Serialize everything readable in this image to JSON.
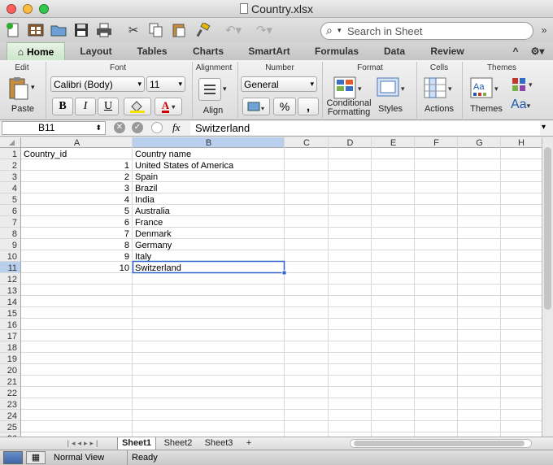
{
  "window": {
    "title": "Country.xlsx"
  },
  "toolbar": {
    "search_placeholder": "Search in Sheet"
  },
  "tabs": [
    "Home",
    "Layout",
    "Tables",
    "Charts",
    "SmartArt",
    "Formulas",
    "Data",
    "Review"
  ],
  "ribbon": {
    "edit": {
      "title": "Edit",
      "paste": "Paste"
    },
    "font": {
      "title": "Font",
      "name": "Calibri (Body)",
      "size": "11",
      "bold": "B",
      "italic": "I",
      "underline": "U",
      "color_glyph": "A"
    },
    "alignment": {
      "title": "Alignment",
      "align": "Align"
    },
    "number": {
      "title": "Number",
      "format": "General",
      "percent": "%",
      "comma": ","
    },
    "format": {
      "title": "Format",
      "conditional_1": "Conditional",
      "conditional_2": "Formatting",
      "styles": "Styles"
    },
    "cells": {
      "title": "Cells",
      "actions": "Actions"
    },
    "themes": {
      "title": "Themes",
      "themes": "Themes",
      "fonts_glyph": "Aa"
    }
  },
  "formula_bar": {
    "cell_ref": "B11",
    "fx": "fx",
    "value": "Switzerland"
  },
  "columns": [
    "A",
    "B",
    "C",
    "D",
    "E",
    "F",
    "G",
    "H"
  ],
  "row_numbers": [
    "1",
    "2",
    "3",
    "4",
    "5",
    "6",
    "7",
    "8",
    "9",
    "10",
    "11",
    "12",
    "13",
    "14",
    "15",
    "16",
    "17",
    "18",
    "19",
    "20",
    "21",
    "22",
    "23",
    "24",
    "25",
    "26"
  ],
  "cells": [
    [
      "Country_id",
      "Country name"
    ],
    [
      "1",
      "United States of America"
    ],
    [
      "2",
      "Spain"
    ],
    [
      "3",
      "Brazil"
    ],
    [
      "4",
      "India"
    ],
    [
      "5",
      "Australia"
    ],
    [
      "6",
      "France"
    ],
    [
      "7",
      "Denmark"
    ],
    [
      "8",
      "Germany"
    ],
    [
      "9",
      "Italy"
    ],
    [
      "10",
      "Switzerland"
    ]
  ],
  "selected_cell": "B11",
  "sheets": [
    "Sheet1",
    "Sheet2",
    "Sheet3"
  ],
  "add_sheet": "+",
  "status": {
    "view": "Normal View",
    "state": "Ready"
  },
  "colors": {
    "accent_tab": "#cde6cb",
    "selection": "#2c62c9",
    "header_highlight": "#b9cfee"
  }
}
